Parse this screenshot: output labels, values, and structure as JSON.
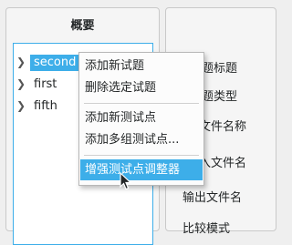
{
  "overview": {
    "title": "概要",
    "items": [
      {
        "label": "second",
        "selected": true
      },
      {
        "label": "first",
        "selected": false
      },
      {
        "label": "fifth",
        "selected": false
      }
    ]
  },
  "properties": {
    "labels": [
      "题标题",
      "题类型",
      "文件名称",
      "入文件名",
      "输出文件名",
      "比较模式"
    ]
  },
  "context_menu": {
    "items": [
      {
        "label": "添加新试题"
      },
      {
        "label": "删除选定试题"
      },
      {
        "label": "添加新测试点"
      },
      {
        "label": "添加多组测试点..."
      },
      {
        "label": "增强测试点调整器",
        "highlighted": true
      }
    ]
  },
  "colors": {
    "accent": "#3daee9"
  }
}
